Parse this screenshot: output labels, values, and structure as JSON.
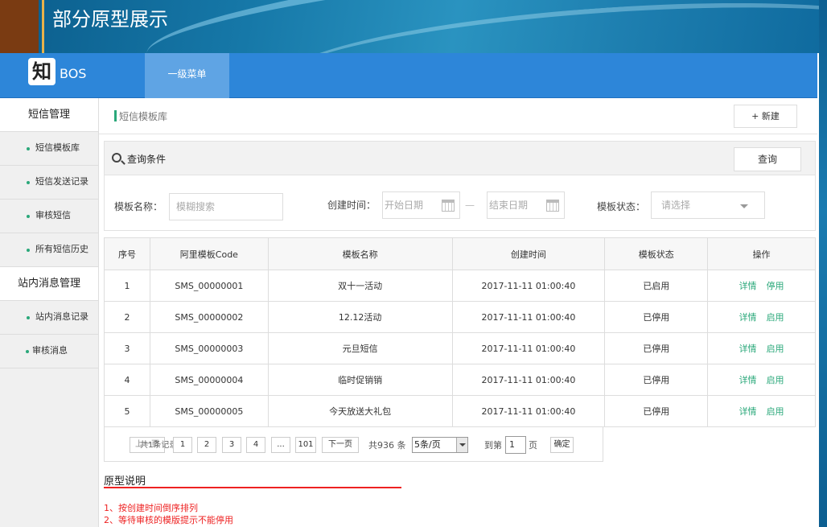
{
  "banner": {
    "title": "部分原型展示"
  },
  "navbar": {
    "logo_char": "知",
    "logo_text": "BOS",
    "menu_item": "一级菜单"
  },
  "sidebar": {
    "groups": [
      {
        "label": "短信管理",
        "items": [
          "短信模板库",
          "短信发送记录",
          "审核短信",
          "所有短信历史"
        ]
      },
      {
        "label": "站内消息管理",
        "items": [
          "站内消息记录",
          "审核消息"
        ]
      }
    ]
  },
  "crumb": {
    "text": "短信模板库",
    "new_button": "+ 新建"
  },
  "query": {
    "title": "查询条件",
    "button": "查询",
    "name_label": "模板名称：",
    "name_placeholder": "模糊搜索",
    "time_label": "创建时间：",
    "start_placeholder": "开始日期",
    "dash": "—",
    "end_placeholder": "结束日期",
    "status_label": "模板状态：",
    "status_placeholder": "请选择"
  },
  "table": {
    "headers": [
      "序号",
      "阿里模板Code",
      "模板名称",
      "创建时间",
      "模板状态",
      "操作"
    ],
    "rows": [
      {
        "no": "1",
        "code": "SMS_00000001",
        "name": "双十一活动",
        "time": "2017-11-11  01:00:40",
        "status": "已启用",
        "op1": "详情",
        "op2": "停用"
      },
      {
        "no": "2",
        "code": "SMS_00000002",
        "name": "12.12活动",
        "time": "2017-11-11  01:00:40",
        "status": "已停用",
        "op1": "详情",
        "op2": "启用"
      },
      {
        "no": "3",
        "code": "SMS_00000003",
        "name": "元旦短信",
        "time": "2017-11-11  01:00:40",
        "status": "已停用",
        "op1": "详情",
        "op2": "启用"
      },
      {
        "no": "4",
        "code": "SMS_00000004",
        "name": "临时促销销",
        "time": "2017-11-11  01:00:40",
        "status": "已停用",
        "op1": "详情",
        "op2": "启用"
      },
      {
        "no": "5",
        "code": "SMS_00000005",
        "name": "今天放送大礼包",
        "time": "2017-11-11  01:00:40",
        "status": "已停用",
        "op1": "详情",
        "op2": "启用"
      }
    ]
  },
  "pager": {
    "prev": "上一页",
    "prev_overlap": "共1条记录",
    "pages": [
      "1",
      "2",
      "3",
      "4",
      "...",
      "101"
    ],
    "next": "下一页",
    "total": "共936 条",
    "per_page": "5条/页",
    "goto_label": "到第",
    "goto_value": "1",
    "page_unit": "页",
    "confirm": "确定"
  },
  "notes": {
    "title": "原型说明",
    "items": [
      "1、按创建时间倒序排列",
      "2、等待审核的模版提示不能停用"
    ]
  }
}
